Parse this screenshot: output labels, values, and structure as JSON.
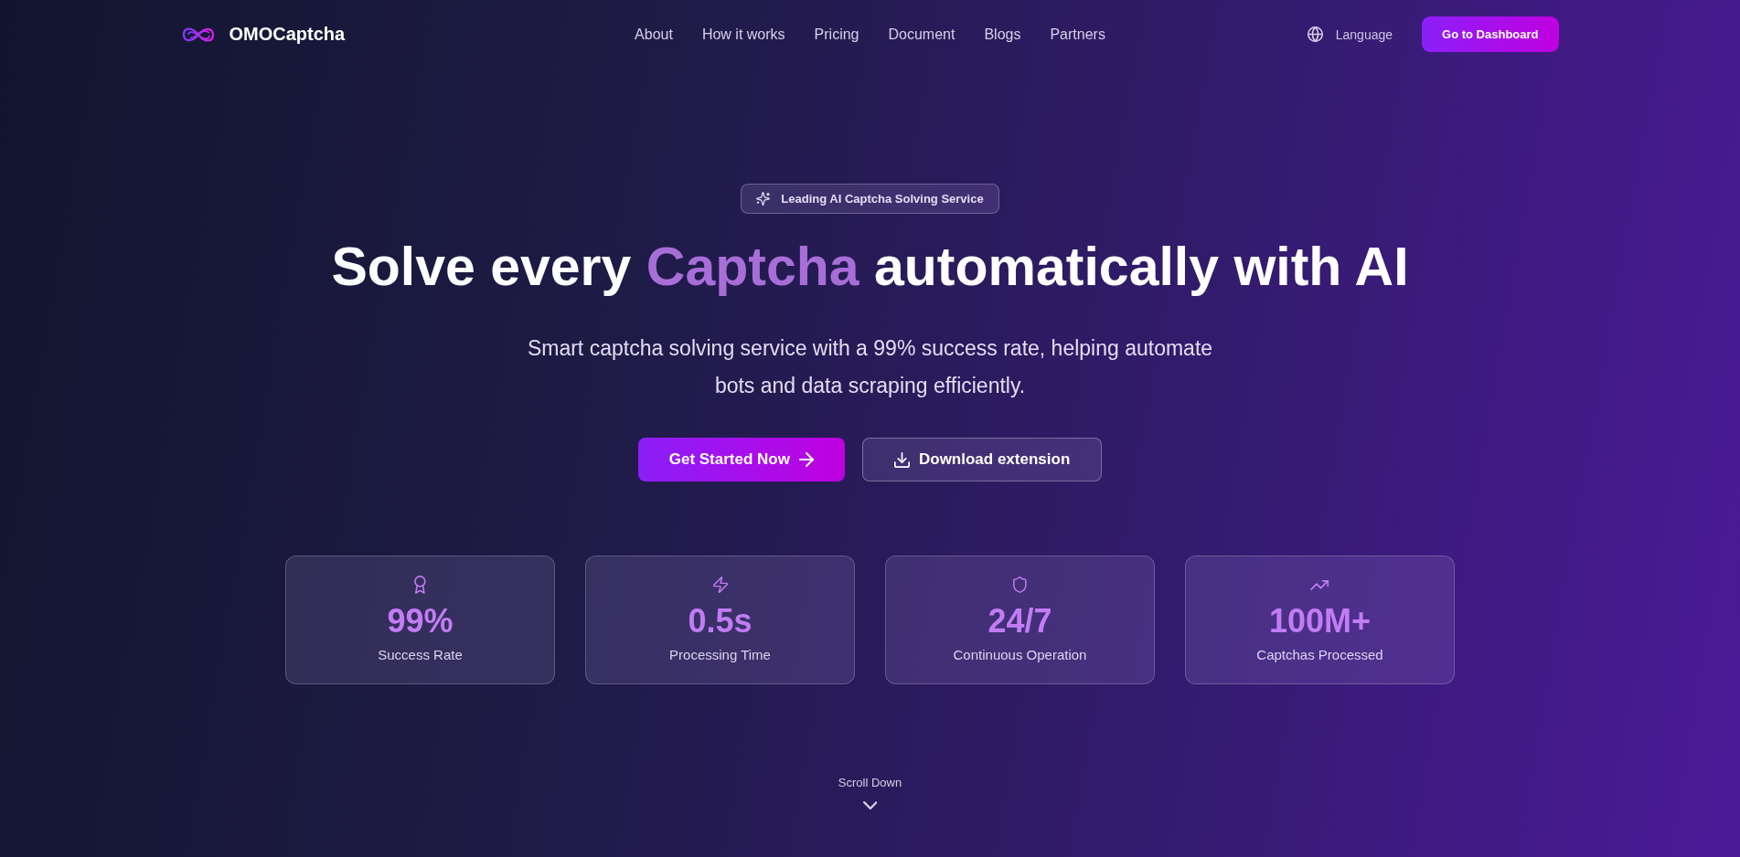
{
  "header": {
    "logo_text": "OMOCaptcha",
    "nav": [
      "About",
      "How it works",
      "Pricing",
      "Document",
      "Blogs",
      "Partners"
    ],
    "language": "Language",
    "dashboard_button": "Go to Dashboard"
  },
  "hero": {
    "badge": "Leading AI Captcha Solving Service",
    "title": [
      {
        "text": "Solve every ",
        "highlight": false
      },
      {
        "text": "Captcha",
        "highlight": true
      },
      {
        "text": " automatically with AI",
        "highlight": false
      }
    ],
    "subtitle": "Smart captcha solving service with a 99% success rate, helping automate bots and data scraping efficiently.",
    "buttons": [
      {
        "kind": "primary",
        "label": "Get Started Now"
      },
      {
        "kind": "secondary",
        "label": "Download extension"
      }
    ]
  },
  "stats": [
    {
      "value": "99%",
      "label": "Success Rate"
    },
    {
      "value": "0.5s",
      "label": "Processing Time"
    },
    {
      "value": "24/7",
      "label": "Continuous Operation"
    },
    {
      "value": "100M+",
      "label": "Captchas Processed"
    }
  ],
  "scroll_hint": "Scroll Down"
}
